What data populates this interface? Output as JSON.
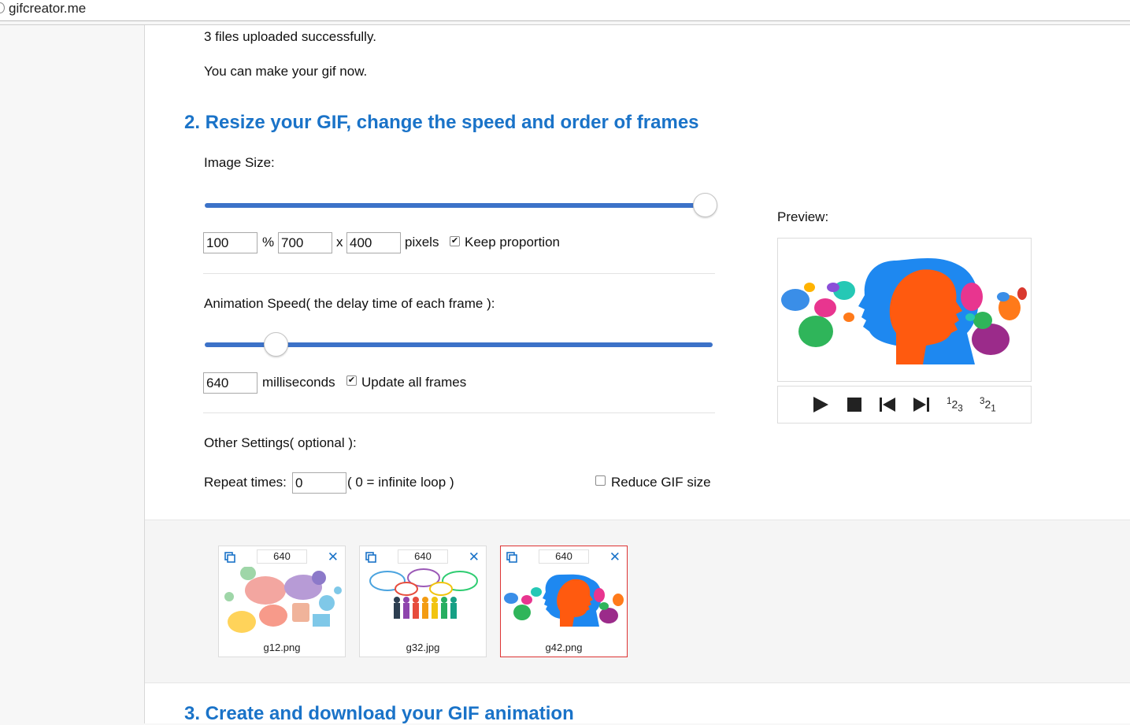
{
  "browser": {
    "url": "gifcreator.me"
  },
  "upload": {
    "status": "3 files uploaded successfully.",
    "hint": "You can make your gif now."
  },
  "section2": {
    "title": "2. Resize your GIF, change the speed and order of frames"
  },
  "image_size": {
    "label": "Image Size:",
    "slider_value_percent": 100,
    "percent_value": "100",
    "percent_sign": "%",
    "width_value": "700",
    "times": "x",
    "height_value": "400",
    "unit": "pixels",
    "keep_proportion_label": "Keep proportion",
    "keep_proportion_checked": true
  },
  "animation_speed": {
    "label": "Animation Speed( the delay time of each frame ):",
    "slider_fraction": 0.14,
    "value": "640",
    "unit": "milliseconds",
    "update_all_label": "Update all frames",
    "update_all_checked": true
  },
  "other_settings": {
    "label": "Other Settings( optional ):",
    "repeat_label": "Repeat times:",
    "repeat_value": "0",
    "repeat_hint": "( 0 = infinite loop )",
    "reduce_label": "Reduce GIF size",
    "reduce_checked": false
  },
  "preview": {
    "label": "Preview:",
    "controls": [
      "play-icon",
      "stop-icon",
      "first-frame-icon",
      "last-frame-icon",
      "order-forward-icon",
      "order-reverse-icon"
    ],
    "order_forward": {
      "base": "1",
      "mid": "2",
      "end": "3"
    },
    "order_reverse": {
      "base": "3",
      "mid": "2",
      "end": "1"
    }
  },
  "frames": [
    {
      "delay": "640",
      "filename": "g12.png",
      "selected": false
    },
    {
      "delay": "640",
      "filename": "g32.jpg",
      "selected": false
    },
    {
      "delay": "640",
      "filename": "g42.png",
      "selected": true
    }
  ],
  "section3": {
    "title": "3. Create and download your GIF animation"
  },
  "colors": {
    "accent": "#1a73c8",
    "slider": "#3c72c8",
    "selected_border": "#dd3333",
    "head_blue": "#1e88f0",
    "head_orange": "#ff5a0f"
  }
}
